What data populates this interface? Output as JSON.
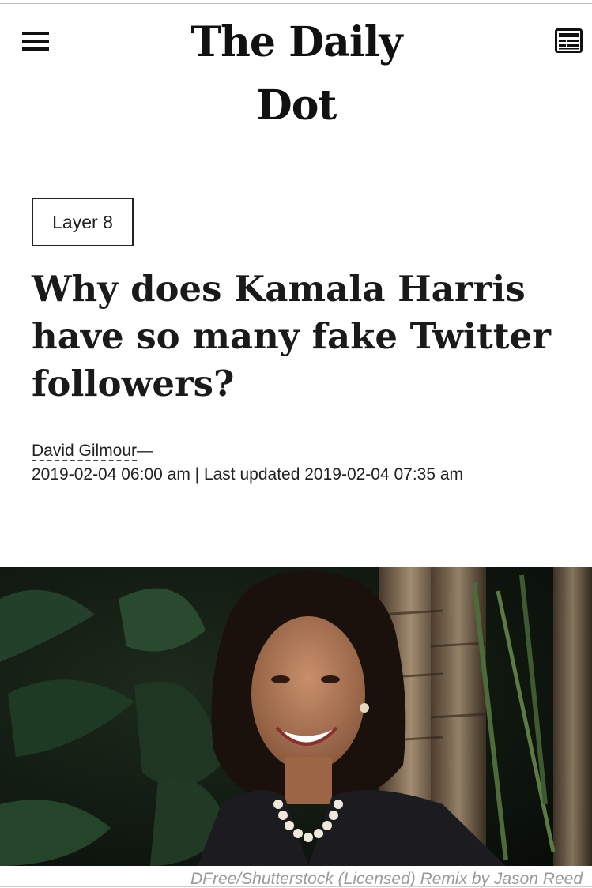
{
  "header": {
    "logo_text": "The Daily Dot",
    "menu_icon": "hamburger-menu-icon",
    "sections_icon": "newspaper-sections-icon"
  },
  "article": {
    "section_tag": "Layer 8",
    "headline": "Why does Kamala Harris have so many fake Twitter followers?",
    "author": "David Gilmour",
    "author_separator": "—",
    "published": "2019-02-04 06:00 am",
    "updated_label": "| Last updated",
    "updated": "2019-02-04 07:35 am"
  },
  "hero_image": {
    "caption": "DFree/Shutterstock (Licensed) Remix by Jason Reed"
  },
  "colors": {
    "text": "#1a1a1a",
    "caption": "#9a9a9a",
    "background": "#ffffff"
  }
}
